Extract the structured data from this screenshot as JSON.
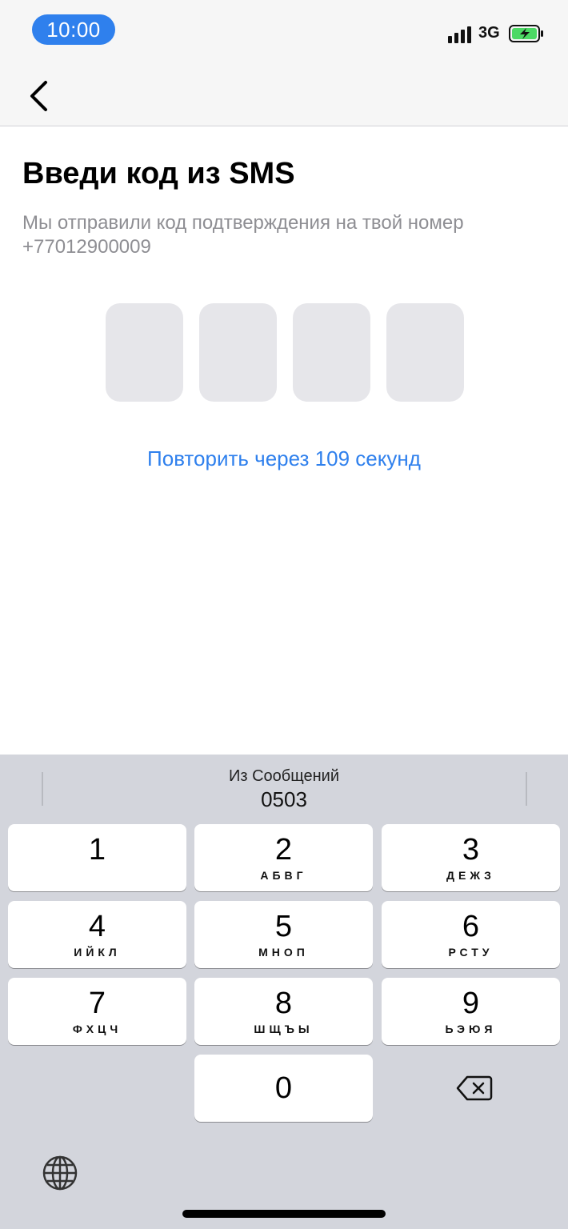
{
  "status_bar": {
    "time": "10:00",
    "network": "3G",
    "icons": [
      "signal-icon",
      "battery-charging-icon"
    ]
  },
  "nav": {
    "back_icon": "chevron-left-icon"
  },
  "screen": {
    "title": "Введи код из SMS",
    "subtitle_line1": "Мы отправили код подтверждения на твой номер",
    "phone": "+77012900009",
    "code_digits": [
      "",
      "",
      "",
      ""
    ],
    "resend": "Повторить через 109 секунд"
  },
  "keyboard": {
    "suggestion_label": "Из Сообщений",
    "suggestion_value": "0503",
    "keys": [
      {
        "digit": "1",
        "letters": ""
      },
      {
        "digit": "2",
        "letters": "АБВГ"
      },
      {
        "digit": "3",
        "letters": "ДЕЖЗ"
      },
      {
        "digit": "4",
        "letters": "ИЙКЛ"
      },
      {
        "digit": "5",
        "letters": "МНОП"
      },
      {
        "digit": "6",
        "letters": "РСТУ"
      },
      {
        "digit": "7",
        "letters": "ФХЦЧ"
      },
      {
        "digit": "8",
        "letters": "ШЩЪЫ"
      },
      {
        "digit": "9",
        "letters": "ЬЭЮЯ"
      },
      {
        "digit": "0",
        "letters": ""
      }
    ],
    "delete_icon": "backspace-icon",
    "globe_icon": "globe-icon"
  },
  "colors": {
    "accent": "#2f80ed",
    "battery": "#4cd964",
    "code_box": "#e6e6ea",
    "keyboard_bg": "#d3d5dc"
  }
}
